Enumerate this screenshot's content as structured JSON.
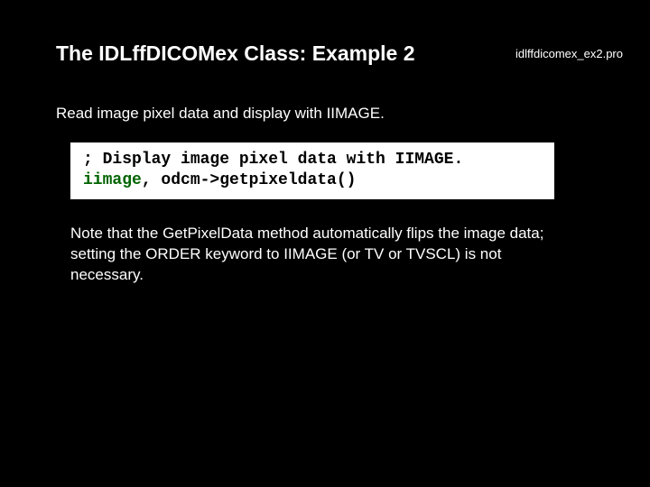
{
  "header": {
    "title": "The IDLffDICOMex Class: Example 2",
    "filename": "idlffdicomex_ex2.pro"
  },
  "intro": "Read image pixel data and display with IIMAGE.",
  "code": {
    "comment": "; Display image pixel data with IIMAGE.",
    "keyword": "iimage",
    "rest": ", odcm->getpixeldata()"
  },
  "note": "Note that the GetPixelData method automatically flips the image data; setting the ORDER keyword to IIMAGE (or TV or TVSCL) is not necessary."
}
